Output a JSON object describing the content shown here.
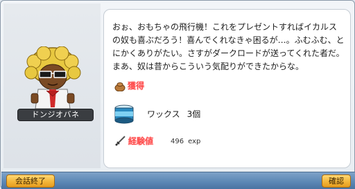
{
  "npc": {
    "name": "ドンジオバネ"
  },
  "dialog": {
    "message": "おぉ、おもちゃの飛行機！これをプレゼントすればイカルスの奴も喜ぶだろう！喜んでくれなきゃ困るが…。ふむふむ、とにかくありがたい。さすがダークロードが送ってくれた者だ。まあ、奴は昔からこういう気配りができたからな。"
  },
  "reward": {
    "label": "獲得",
    "item": {
      "name": "ワックス",
      "count": "3個"
    },
    "exp": {
      "label": "経験値",
      "value": "496",
      "unit": "exp"
    }
  },
  "buttons": {
    "end_conversation": "会話終了",
    "confirm": "確認"
  },
  "colors": {
    "reward_label": "#ff4a4a",
    "bottom_bar": "#5a86b4",
    "button": "#f3b63a"
  },
  "icons": {
    "reward": "bag-icon",
    "item": "wax-can-icon",
    "exp": "dagger-icon"
  }
}
